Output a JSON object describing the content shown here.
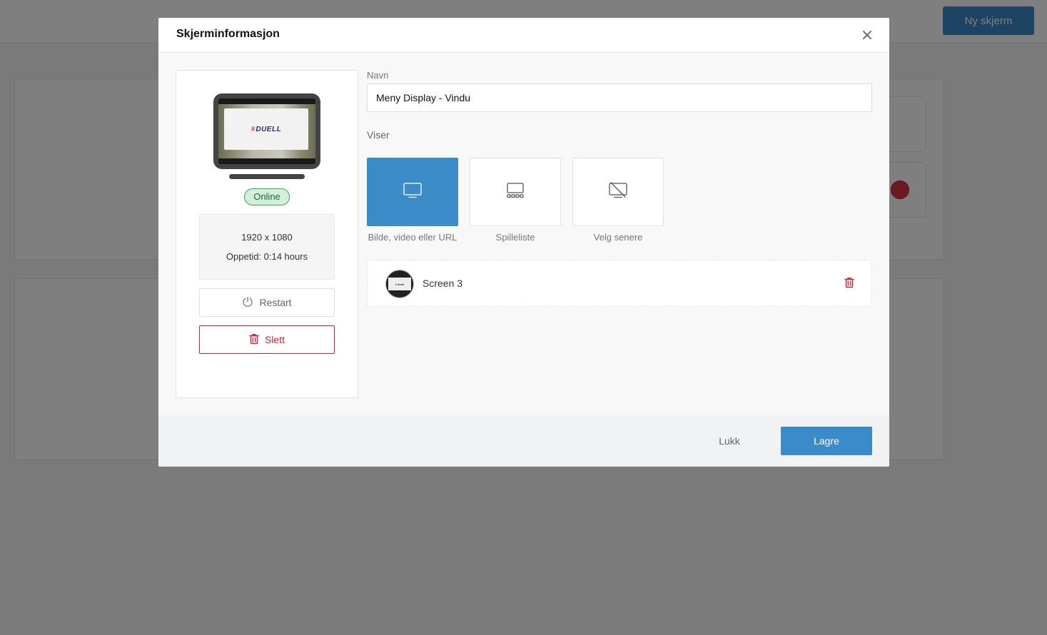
{
  "background": {
    "new_screen_button": "Ny skjerm"
  },
  "modal": {
    "title": "Skjerminformasjon",
    "close_symbol": "×",
    "preview": {
      "logo_hash": "#",
      "logo_text": "DUELL"
    },
    "status": "Online",
    "resolution": "1920 x 1080",
    "uptime": "Oppetid: 0:14 hours",
    "restart_label": "Restart",
    "delete_label": "Slett",
    "name_label": "Navn",
    "name_value": "Meny Display - Vindu",
    "shows_label": "Viser",
    "options": [
      {
        "label": "Bilde, video eller URL",
        "icon": "monitor-icon",
        "selected": true
      },
      {
        "label": "Spilleliste",
        "icon": "playlist-icon",
        "selected": false
      },
      {
        "label": "Velg senere",
        "icon": "monitor-off-icon",
        "selected": false
      }
    ],
    "content_item": {
      "name": "Screen 3",
      "thumb_text": "# duell"
    },
    "footer": {
      "close_label": "Lukk",
      "save_label": "Lagre"
    }
  },
  "colors": {
    "primary": "#3a8bc7",
    "danger": "#c82333",
    "success_bg": "#d4f0dc",
    "success_border": "#34a853"
  }
}
